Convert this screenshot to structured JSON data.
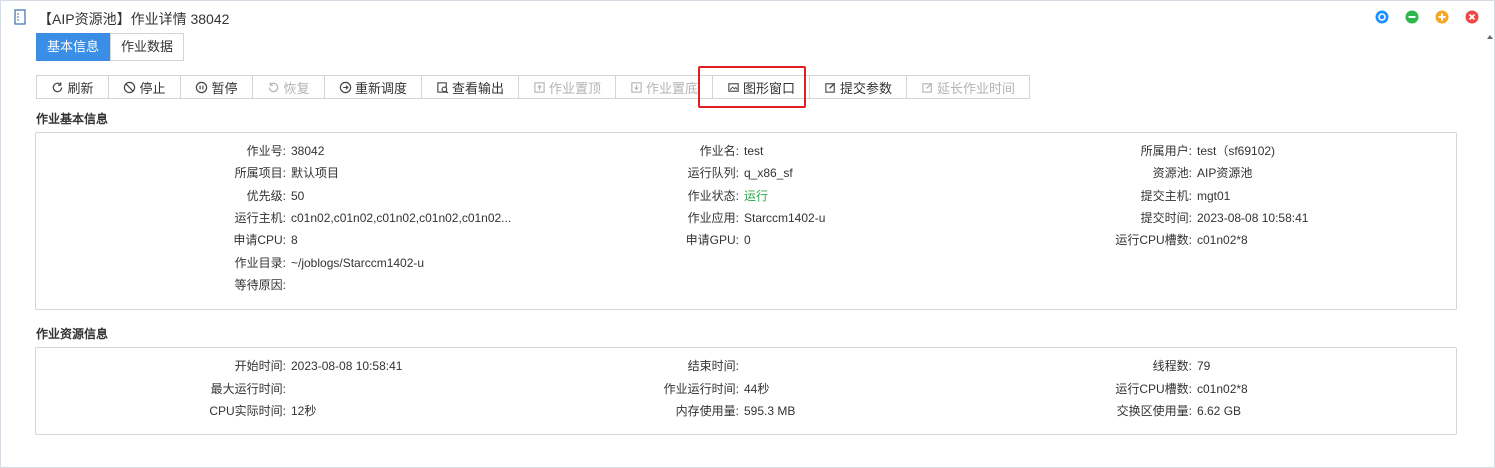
{
  "window": {
    "title": "【AIP资源池】作业详情 38042",
    "controls": [
      {
        "name": "restore",
        "color": "#1e90ff"
      },
      {
        "name": "minimize",
        "color": "#2db84d"
      },
      {
        "name": "maximize",
        "color": "#f5a623"
      },
      {
        "name": "close",
        "color": "#f04848"
      }
    ]
  },
  "tabs": [
    {
      "label": "基本信息",
      "active": true
    },
    {
      "label": "作业数据",
      "active": false
    }
  ],
  "toolbar": [
    {
      "label": "刷新",
      "icon": "refresh-icon",
      "enabled": true
    },
    {
      "label": "停止",
      "icon": "stop-icon",
      "enabled": true
    },
    {
      "label": "暂停",
      "icon": "pause-icon",
      "enabled": true
    },
    {
      "label": "恢复",
      "icon": "resume-icon",
      "enabled": false
    },
    {
      "label": "重新调度",
      "icon": "reschedule-icon",
      "enabled": true
    },
    {
      "label": "查看输出",
      "icon": "view-output-icon",
      "enabled": true
    },
    {
      "label": "作业置顶",
      "icon": "move-top-icon",
      "enabled": false
    },
    {
      "label": "作业置底",
      "icon": "move-bottom-icon",
      "enabled": false
    },
    {
      "label": "图形窗口",
      "icon": "graphic-window-icon",
      "enabled": true
    },
    {
      "label": "提交参数",
      "icon": "edit-icon",
      "enabled": true
    },
    {
      "label": "延长作业时间",
      "icon": "extend-time-icon",
      "enabled": false
    }
  ],
  "basic": {
    "title": "作业基本信息",
    "rows": [
      [
        {
          "label": "作业号:",
          "value": "38042"
        },
        {
          "label": "作业名:",
          "value": "test"
        },
        {
          "label": "所属用户:",
          "value": "test（sf69102)"
        }
      ],
      [
        {
          "label": "所属项目:",
          "value": "默认项目"
        },
        {
          "label": "运行队列:",
          "value": "q_x86_sf"
        },
        {
          "label": "资源池:",
          "value": "AIP资源池"
        }
      ],
      [
        {
          "label": "优先级:",
          "value": "50"
        },
        {
          "label": "作业状态:",
          "value": "运行",
          "status": "running"
        },
        {
          "label": "提交主机:",
          "value": "mgt01"
        }
      ],
      [
        {
          "label": "运行主机:",
          "value": "c01n02,c01n02,c01n02,c01n02,c01n02..."
        },
        {
          "label": "作业应用:",
          "value": "Starccm1402-u"
        },
        {
          "label": "提交时间:",
          "value": "2023-08-08 10:58:41"
        }
      ],
      [
        {
          "label": "申请CPU:",
          "value": "8"
        },
        {
          "label": "申请GPU:",
          "value": "0"
        },
        {
          "label": "运行CPU槽数:",
          "value": "c01n02*8"
        }
      ],
      [
        {
          "label": "作业目录:",
          "value": "~/joblogs/Starccm1402-u"
        }
      ],
      [
        {
          "label": "等待原因:",
          "value": ""
        }
      ]
    ]
  },
  "resource": {
    "title": "作业资源信息",
    "rows": [
      [
        {
          "label": "开始时间:",
          "value": "2023-08-08 10:58:41"
        },
        {
          "label": "结束时间:",
          "value": ""
        },
        {
          "label": "线程数:",
          "value": "79"
        }
      ],
      [
        {
          "label": "最大运行时间:",
          "value": ""
        },
        {
          "label": "作业运行时间:",
          "value": "44秒"
        },
        {
          "label": "运行CPU槽数:",
          "value": "c01n02*8"
        }
      ],
      [
        {
          "label": "CPU实际时间:",
          "value": "12秒"
        },
        {
          "label": "内存使用量:",
          "value": "595.3 MB"
        },
        {
          "label": "交换区使用量:",
          "value": "6.62 GB"
        }
      ]
    ]
  },
  "colors": {
    "accent": "#3a8ee6",
    "running": "#2aa84a",
    "highlight": "#e02020"
  }
}
